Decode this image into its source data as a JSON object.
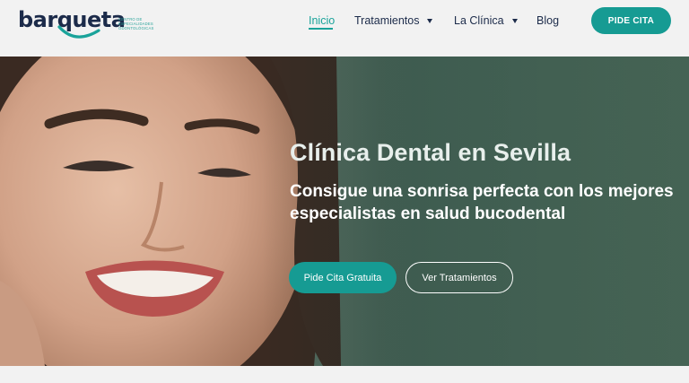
{
  "brand": {
    "logo_text_before": "bar",
    "logo_text_q": "q",
    "logo_text_after": "ueta",
    "tagline": "CENTRO DE ESPECIALIDADES ODONTOLÓGICAS"
  },
  "nav": {
    "items": [
      {
        "label": "Inicio",
        "active": true
      },
      {
        "label": "Tratamientos",
        "dropdown": true
      },
      {
        "label": "La Clínica",
        "dropdown": true
      },
      {
        "label": "Blog"
      }
    ],
    "cta_label": "PIDE CITA"
  },
  "hero": {
    "title": "Clínica Dental en Sevilla",
    "subtitle": "Consigue una sonrisa perfecta con los mejores especialistas en salud bucodental",
    "primary_button": "Pide Cita Gratuita",
    "secondary_button": "Ver Tratamientos"
  },
  "colors": {
    "accent": "#169b93",
    "navy": "#1c2b4a",
    "background": "#f2f2f2"
  }
}
